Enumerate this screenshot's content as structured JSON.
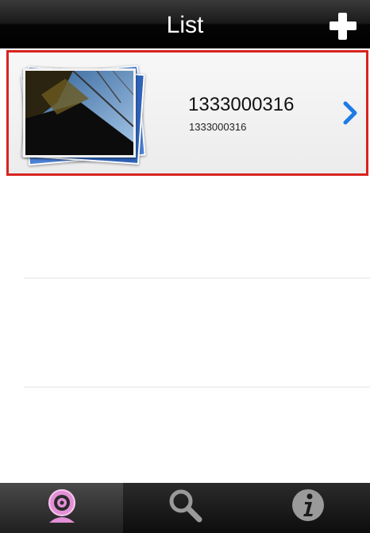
{
  "navbar": {
    "title": "List",
    "add_icon": "plus-icon"
  },
  "list": {
    "items": [
      {
        "title": "1333000316",
        "subtitle": "1333000316",
        "thumbnail_icon": "camera-snapshot-stack",
        "chevron_icon": "chevron-right-icon",
        "selected": true
      }
    ]
  },
  "tabbar": {
    "tabs": [
      {
        "icon": "webcam-icon",
        "active": true
      },
      {
        "icon": "search-icon",
        "active": false
      },
      {
        "icon": "info-icon",
        "active": false
      }
    ]
  },
  "colors": {
    "selection_border": "#d8231f",
    "chevron": "#1e7be6",
    "active_tab_icon": "#e38fd6"
  }
}
